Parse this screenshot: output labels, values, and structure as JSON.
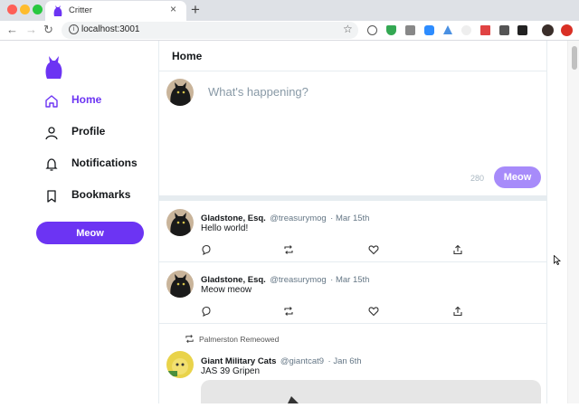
{
  "browser": {
    "tab_title": "Critter",
    "tab_close": "×",
    "new_tab": "+",
    "url": "localhost:3001",
    "traffic_colors": [
      "#fe5f57",
      "#febc2e",
      "#28c840"
    ]
  },
  "app": {
    "accent": "#6c34f3",
    "nav": [
      {
        "label": "Home",
        "icon": "home-icon",
        "active": true
      },
      {
        "label": "Profile",
        "icon": "profile-icon",
        "active": false
      },
      {
        "label": "Notifications",
        "icon": "bell-icon",
        "active": false
      },
      {
        "label": "Bookmarks",
        "icon": "bookmark-icon",
        "active": false
      }
    ],
    "sidebar_button": "Meow"
  },
  "feed": {
    "title": "Home",
    "compose": {
      "placeholder": "What's happening?",
      "char_count": "280",
      "button": "Meow"
    },
    "tweets": [
      {
        "name": "Gladstone, Esq.",
        "handle": "@treasurymog",
        "date": "· Mar 15th",
        "text": "Hello world!",
        "retweeted_by": ""
      },
      {
        "name": "Gladstone, Esq.",
        "handle": "@treasurymog",
        "date": "· Mar 15th",
        "text": "Meow meow",
        "retweeted_by": ""
      },
      {
        "name": "Giant Military Cats",
        "handle": "@giantcat9",
        "date": "· Jan 6th",
        "text": "JAS 39 Gripen",
        "retweeted_by": "Palmerston Remeowed"
      }
    ]
  }
}
